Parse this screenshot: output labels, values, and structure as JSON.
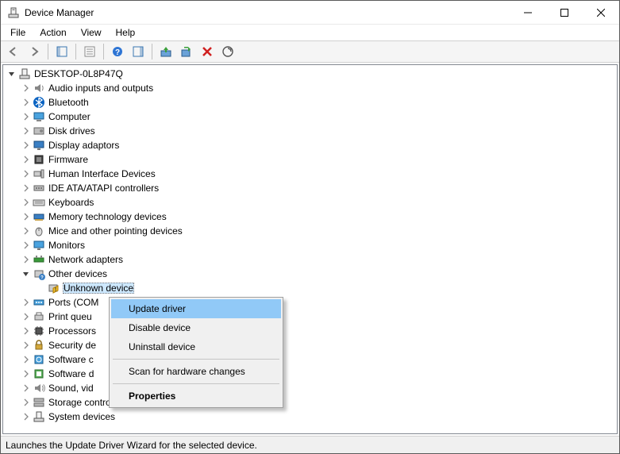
{
  "window": {
    "title": "Device Manager"
  },
  "menu": {
    "file": "File",
    "action": "Action",
    "view": "View",
    "help": "Help"
  },
  "tree": {
    "root": "DESKTOP-0L8P47Q",
    "categories": [
      {
        "icon": "audio",
        "label": "Audio inputs and outputs",
        "expanded": false
      },
      {
        "icon": "bluetooth",
        "label": "Bluetooth",
        "expanded": false
      },
      {
        "icon": "computer",
        "label": "Computer",
        "expanded": false
      },
      {
        "icon": "disk",
        "label": "Disk drives",
        "expanded": false
      },
      {
        "icon": "display",
        "label": "Display adaptors",
        "expanded": false
      },
      {
        "icon": "firmware",
        "label": "Firmware",
        "expanded": false
      },
      {
        "icon": "hid",
        "label": "Human Interface Devices",
        "expanded": false
      },
      {
        "icon": "ide",
        "label": "IDE ATA/ATAPI controllers",
        "expanded": false
      },
      {
        "icon": "keyboard",
        "label": "Keyboards",
        "expanded": false
      },
      {
        "icon": "memtech",
        "label": "Memory technology devices",
        "expanded": false
      },
      {
        "icon": "mouse",
        "label": "Mice and other pointing devices",
        "expanded": false
      },
      {
        "icon": "monitor",
        "label": "Monitors",
        "expanded": false
      },
      {
        "icon": "network",
        "label": "Network adapters",
        "expanded": false
      },
      {
        "icon": "other",
        "label": "Other devices",
        "expanded": true,
        "children": [
          {
            "icon": "unknown",
            "label": "Unknown device",
            "selected": true
          }
        ]
      },
      {
        "icon": "ports",
        "label": "Ports (COM",
        "expanded": false
      },
      {
        "icon": "printq",
        "label": "Print queu",
        "expanded": false
      },
      {
        "icon": "cpu",
        "label": "Processors",
        "expanded": false
      },
      {
        "icon": "security",
        "label": "Security de",
        "expanded": false
      },
      {
        "icon": "softcomp",
        "label": "Software c",
        "expanded": false
      },
      {
        "icon": "softdev",
        "label": "Software d",
        "expanded": false
      },
      {
        "icon": "sound",
        "label": "Sound, vid",
        "expanded": false
      },
      {
        "icon": "storage",
        "label": "Storage controllers",
        "expanded": false
      },
      {
        "icon": "sysdev",
        "label": "System devices",
        "expanded": false
      }
    ]
  },
  "context_menu": {
    "update": "Update driver",
    "disable": "Disable device",
    "uninstall": "Uninstall device",
    "scan": "Scan for hardware changes",
    "properties": "Properties"
  },
  "statusbar": "Launches the Update Driver Wizard for the selected device."
}
